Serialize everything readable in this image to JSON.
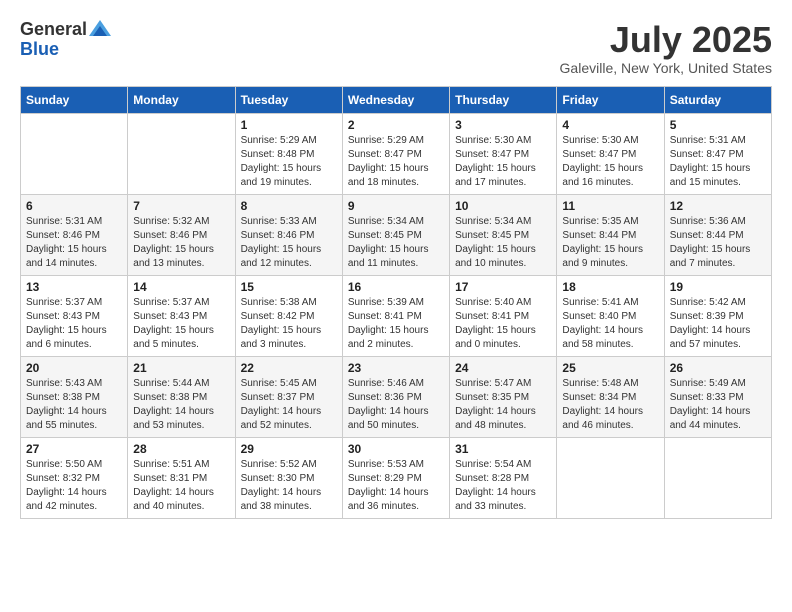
{
  "logo": {
    "general": "General",
    "blue": "Blue"
  },
  "title": {
    "month_year": "July 2025",
    "location": "Galeville, New York, United States"
  },
  "headers": [
    "Sunday",
    "Monday",
    "Tuesday",
    "Wednesday",
    "Thursday",
    "Friday",
    "Saturday"
  ],
  "weeks": [
    [
      {
        "day": "",
        "sunrise": "",
        "sunset": "",
        "daylight": ""
      },
      {
        "day": "",
        "sunrise": "",
        "sunset": "",
        "daylight": ""
      },
      {
        "day": "1",
        "sunrise": "Sunrise: 5:29 AM",
        "sunset": "Sunset: 8:48 PM",
        "daylight": "Daylight: 15 hours and 19 minutes."
      },
      {
        "day": "2",
        "sunrise": "Sunrise: 5:29 AM",
        "sunset": "Sunset: 8:47 PM",
        "daylight": "Daylight: 15 hours and 18 minutes."
      },
      {
        "day": "3",
        "sunrise": "Sunrise: 5:30 AM",
        "sunset": "Sunset: 8:47 PM",
        "daylight": "Daylight: 15 hours and 17 minutes."
      },
      {
        "day": "4",
        "sunrise": "Sunrise: 5:30 AM",
        "sunset": "Sunset: 8:47 PM",
        "daylight": "Daylight: 15 hours and 16 minutes."
      },
      {
        "day": "5",
        "sunrise": "Sunrise: 5:31 AM",
        "sunset": "Sunset: 8:47 PM",
        "daylight": "Daylight: 15 hours and 15 minutes."
      }
    ],
    [
      {
        "day": "6",
        "sunrise": "Sunrise: 5:31 AM",
        "sunset": "Sunset: 8:46 PM",
        "daylight": "Daylight: 15 hours and 14 minutes."
      },
      {
        "day": "7",
        "sunrise": "Sunrise: 5:32 AM",
        "sunset": "Sunset: 8:46 PM",
        "daylight": "Daylight: 15 hours and 13 minutes."
      },
      {
        "day": "8",
        "sunrise": "Sunrise: 5:33 AM",
        "sunset": "Sunset: 8:46 PM",
        "daylight": "Daylight: 15 hours and 12 minutes."
      },
      {
        "day": "9",
        "sunrise": "Sunrise: 5:34 AM",
        "sunset": "Sunset: 8:45 PM",
        "daylight": "Daylight: 15 hours and 11 minutes."
      },
      {
        "day": "10",
        "sunrise": "Sunrise: 5:34 AM",
        "sunset": "Sunset: 8:45 PM",
        "daylight": "Daylight: 15 hours and 10 minutes."
      },
      {
        "day": "11",
        "sunrise": "Sunrise: 5:35 AM",
        "sunset": "Sunset: 8:44 PM",
        "daylight": "Daylight: 15 hours and 9 minutes."
      },
      {
        "day": "12",
        "sunrise": "Sunrise: 5:36 AM",
        "sunset": "Sunset: 8:44 PM",
        "daylight": "Daylight: 15 hours and 7 minutes."
      }
    ],
    [
      {
        "day": "13",
        "sunrise": "Sunrise: 5:37 AM",
        "sunset": "Sunset: 8:43 PM",
        "daylight": "Daylight: 15 hours and 6 minutes."
      },
      {
        "day": "14",
        "sunrise": "Sunrise: 5:37 AM",
        "sunset": "Sunset: 8:43 PM",
        "daylight": "Daylight: 15 hours and 5 minutes."
      },
      {
        "day": "15",
        "sunrise": "Sunrise: 5:38 AM",
        "sunset": "Sunset: 8:42 PM",
        "daylight": "Daylight: 15 hours and 3 minutes."
      },
      {
        "day": "16",
        "sunrise": "Sunrise: 5:39 AM",
        "sunset": "Sunset: 8:41 PM",
        "daylight": "Daylight: 15 hours and 2 minutes."
      },
      {
        "day": "17",
        "sunrise": "Sunrise: 5:40 AM",
        "sunset": "Sunset: 8:41 PM",
        "daylight": "Daylight: 15 hours and 0 minutes."
      },
      {
        "day": "18",
        "sunrise": "Sunrise: 5:41 AM",
        "sunset": "Sunset: 8:40 PM",
        "daylight": "Daylight: 14 hours and 58 minutes."
      },
      {
        "day": "19",
        "sunrise": "Sunrise: 5:42 AM",
        "sunset": "Sunset: 8:39 PM",
        "daylight": "Daylight: 14 hours and 57 minutes."
      }
    ],
    [
      {
        "day": "20",
        "sunrise": "Sunrise: 5:43 AM",
        "sunset": "Sunset: 8:38 PM",
        "daylight": "Daylight: 14 hours and 55 minutes."
      },
      {
        "day": "21",
        "sunrise": "Sunrise: 5:44 AM",
        "sunset": "Sunset: 8:38 PM",
        "daylight": "Daylight: 14 hours and 53 minutes."
      },
      {
        "day": "22",
        "sunrise": "Sunrise: 5:45 AM",
        "sunset": "Sunset: 8:37 PM",
        "daylight": "Daylight: 14 hours and 52 minutes."
      },
      {
        "day": "23",
        "sunrise": "Sunrise: 5:46 AM",
        "sunset": "Sunset: 8:36 PM",
        "daylight": "Daylight: 14 hours and 50 minutes."
      },
      {
        "day": "24",
        "sunrise": "Sunrise: 5:47 AM",
        "sunset": "Sunset: 8:35 PM",
        "daylight": "Daylight: 14 hours and 48 minutes."
      },
      {
        "day": "25",
        "sunrise": "Sunrise: 5:48 AM",
        "sunset": "Sunset: 8:34 PM",
        "daylight": "Daylight: 14 hours and 46 minutes."
      },
      {
        "day": "26",
        "sunrise": "Sunrise: 5:49 AM",
        "sunset": "Sunset: 8:33 PM",
        "daylight": "Daylight: 14 hours and 44 minutes."
      }
    ],
    [
      {
        "day": "27",
        "sunrise": "Sunrise: 5:50 AM",
        "sunset": "Sunset: 8:32 PM",
        "daylight": "Daylight: 14 hours and 42 minutes."
      },
      {
        "day": "28",
        "sunrise": "Sunrise: 5:51 AM",
        "sunset": "Sunset: 8:31 PM",
        "daylight": "Daylight: 14 hours and 40 minutes."
      },
      {
        "day": "29",
        "sunrise": "Sunrise: 5:52 AM",
        "sunset": "Sunset: 8:30 PM",
        "daylight": "Daylight: 14 hours and 38 minutes."
      },
      {
        "day": "30",
        "sunrise": "Sunrise: 5:53 AM",
        "sunset": "Sunset: 8:29 PM",
        "daylight": "Daylight: 14 hours and 36 minutes."
      },
      {
        "day": "31",
        "sunrise": "Sunrise: 5:54 AM",
        "sunset": "Sunset: 8:28 PM",
        "daylight": "Daylight: 14 hours and 33 minutes."
      },
      {
        "day": "",
        "sunrise": "",
        "sunset": "",
        "daylight": ""
      },
      {
        "day": "",
        "sunrise": "",
        "sunset": "",
        "daylight": ""
      }
    ]
  ]
}
